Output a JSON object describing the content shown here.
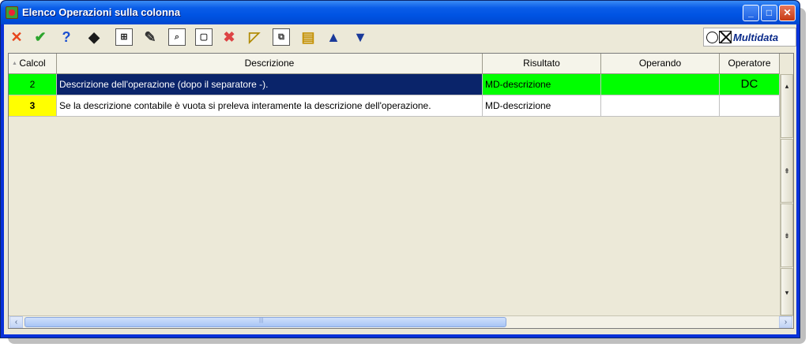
{
  "window": {
    "title": "Elenco Operazioni sulla colonna",
    "minimize": "_",
    "maximize": "□",
    "close": "✕"
  },
  "toolbar": {
    "tools": [
      {
        "icon": "cancel-icon",
        "glyph": "✕",
        "color": "#e8451b"
      },
      {
        "icon": "confirm-icon",
        "glyph": "✔",
        "color": "#2ca52c"
      },
      {
        "icon": "help-icon",
        "glyph": "?",
        "color": "#1a4fd0"
      },
      {
        "icon": "goto-icon",
        "glyph": "◆",
        "color": "#1b1b1b"
      },
      {
        "icon": "find-icon",
        "glyph": "⊞",
        "color": "#222"
      },
      {
        "icon": "edit-icon",
        "glyph": "✎",
        "color": "#333"
      },
      {
        "icon": "preview-icon",
        "glyph": "⌕",
        "color": "#333"
      },
      {
        "icon": "new-icon",
        "glyph": "▢",
        "color": "#333"
      },
      {
        "icon": "delete-icon",
        "glyph": "✖",
        "color": "#d44"
      },
      {
        "icon": "properties-icon",
        "glyph": "◸",
        "color": "#b08a00"
      },
      {
        "icon": "copy-icon",
        "glyph": "⧉",
        "color": "#333"
      },
      {
        "icon": "database-icon",
        "glyph": "▤",
        "color": "#c49000"
      },
      {
        "icon": "move-up-icon",
        "glyph": "▲",
        "color": "#1a3a9a"
      },
      {
        "icon": "move-down-icon",
        "glyph": "▼",
        "color": "#1a3a9a"
      }
    ],
    "logo": "Multidata"
  },
  "table": {
    "columns": [
      "Calcol",
      "Descrizione",
      "Risultato",
      "Operando",
      "Operatore"
    ],
    "sort_indicator": "▲",
    "rows": [
      {
        "calcol": "2",
        "descrizione": "Descrizione dell'operazione (dopo il separatore -).",
        "risultato": "MD-descrizione",
        "operando": "",
        "operatore": "DC"
      },
      {
        "calcol": "3",
        "descrizione": "Se la descrizione contabile è vuota si preleva interamente la descrizione dell'operazione.",
        "risultato": "MD-descrizione",
        "operando": "",
        "operatore": ""
      }
    ]
  },
  "scrollbar": {
    "up": "▴",
    "page_up": "⇞",
    "page_down": "⇟",
    "down": "▾",
    "left": "‹",
    "right": "›",
    "grip": "|||"
  },
  "colors": {
    "green": "#00ff00",
    "yellow": "#ffff00",
    "selected": "#0a246a",
    "titlebar": "#0054e3"
  }
}
